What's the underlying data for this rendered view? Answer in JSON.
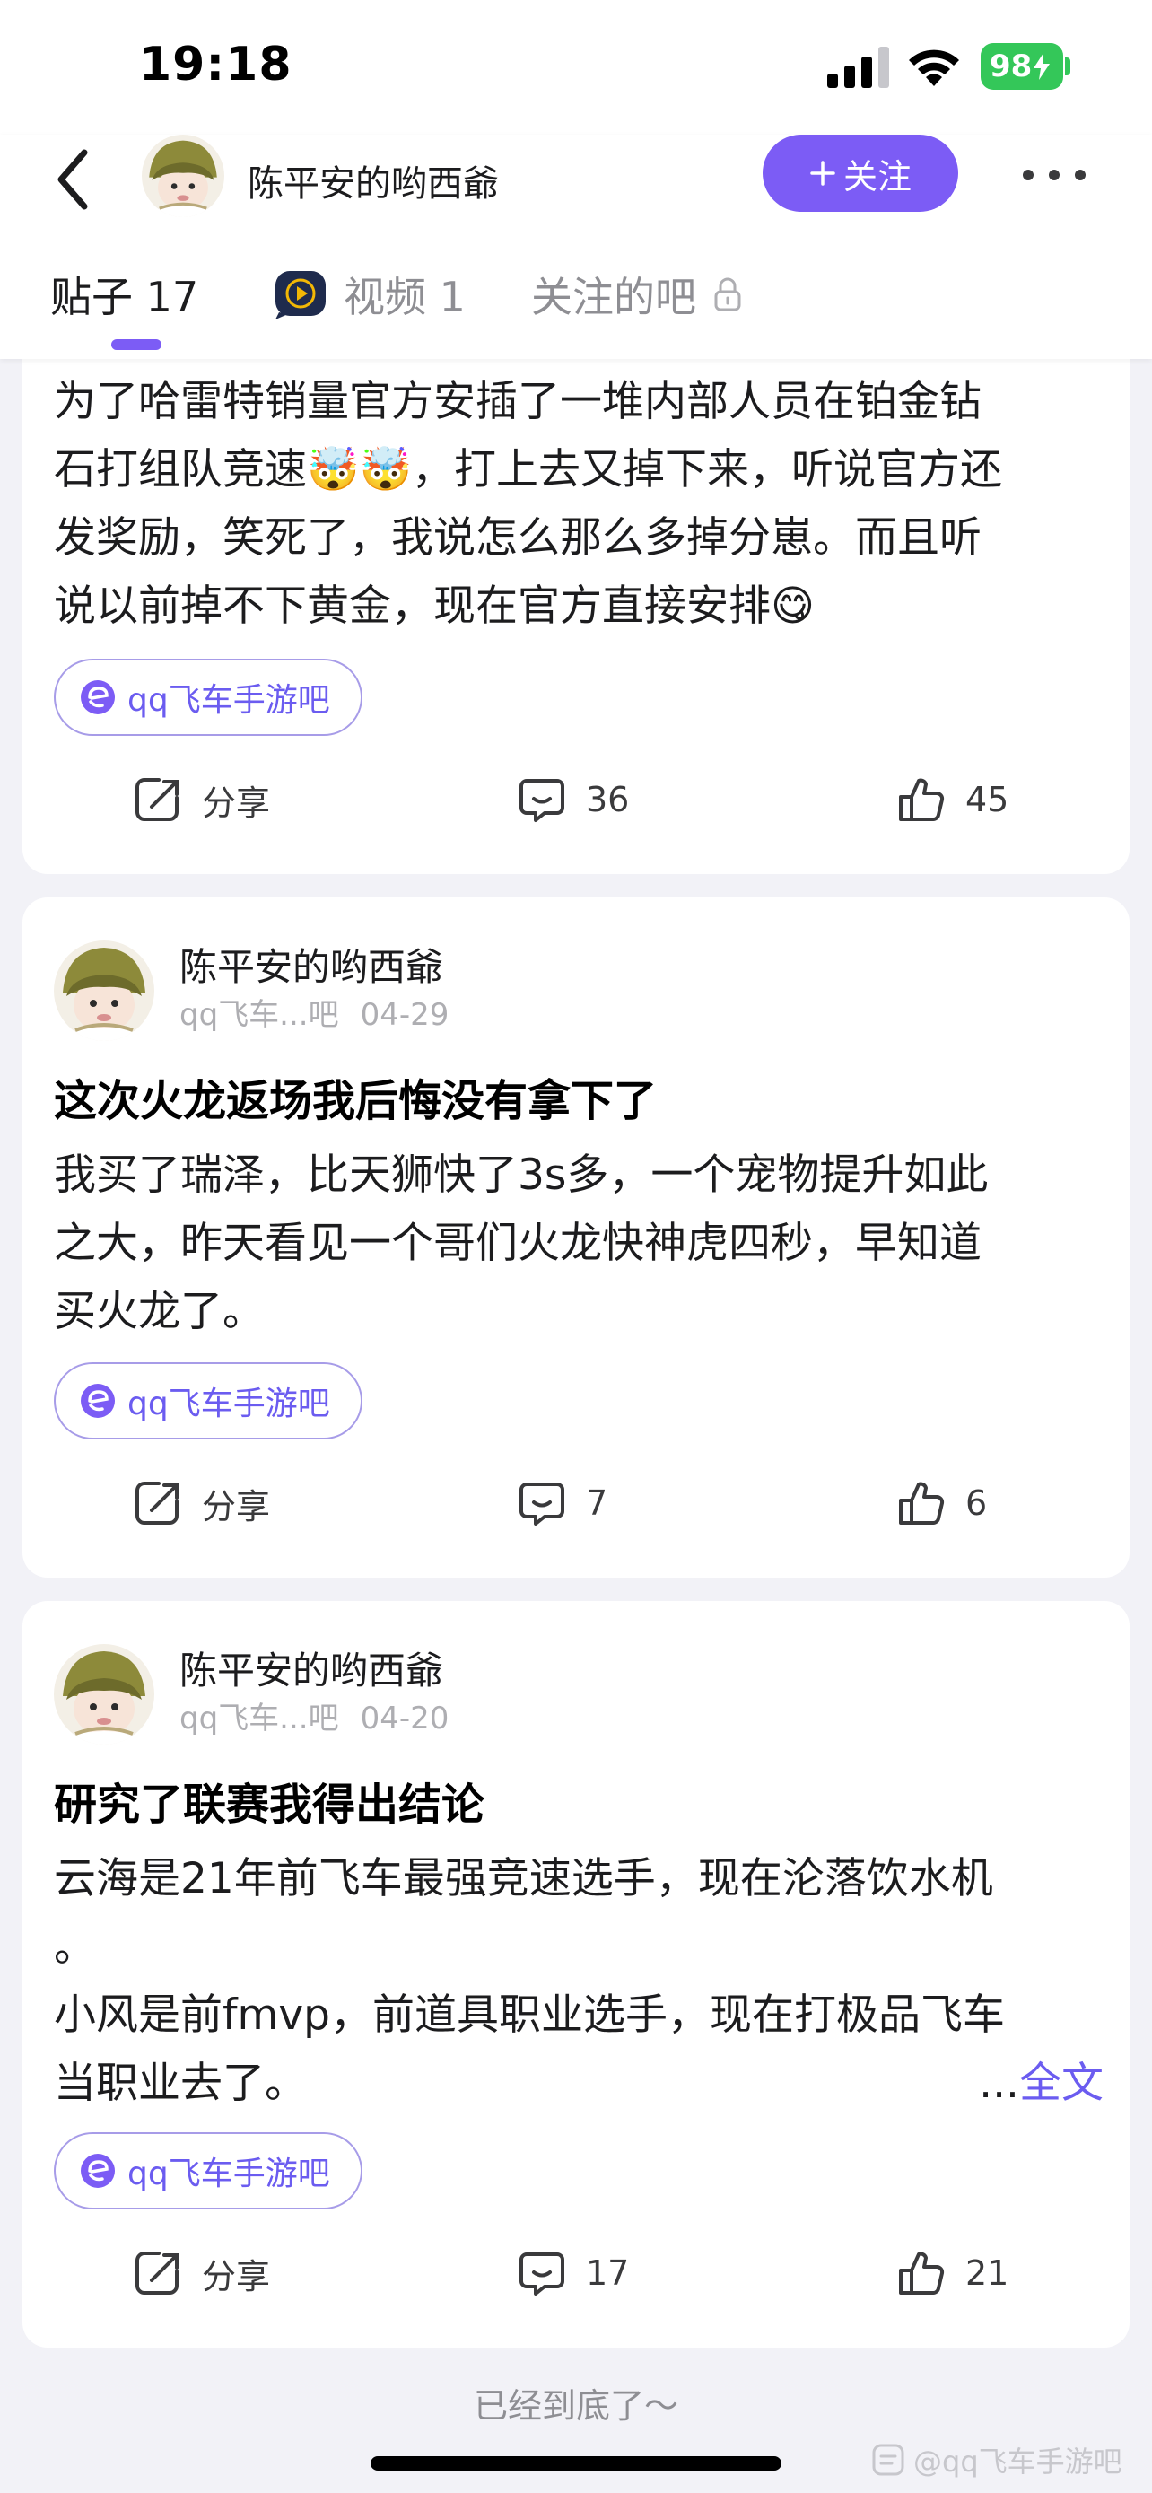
{
  "status_bar": {
    "time": "19:18",
    "battery": "98"
  },
  "nav": {
    "user_name": "陈平安的哟西爺",
    "follow_label": "关注",
    "tabs": {
      "posts": "贴子 17",
      "videos": "视频 1",
      "followed_bars": "关注的吧"
    }
  },
  "posts": [
    {
      "body_lines": [
        "为了哈雷特销量官方安插了一堆内部人员在铂金钻",
        "石打组队竞速🤯🤯，打上去又掉下来，听说官方还",
        "发奖励，笑死了，我说怎么那么多掉分崽。而且听",
        "说以前掉不下黄金，现在官方直接安排😋"
      ],
      "tag": "qq飞车手游吧",
      "share_label": "分享",
      "comments": "36",
      "likes": "45"
    },
    {
      "author": "陈平安的哟西爺",
      "forum": "qq飞车...吧",
      "date": "04-29",
      "title": "这次火龙返场我后悔没有拿下了",
      "body_lines": [
        "我买了瑞泽，比天狮快了3s多，一个宠物提升如此",
        "之大，昨天看见一个哥们火龙快神虎四秒，早知道",
        "买火龙了。"
      ],
      "tag": "qq飞车手游吧",
      "share_label": "分享",
      "comments": "7",
      "likes": "6"
    },
    {
      "author": "陈平安的哟西爺",
      "forum": "qq飞车...吧",
      "date": "04-20",
      "title": "研究了联赛我得出结论",
      "body_lines": [
        "云海是21年前飞车最强竞速选手，现在沦落饮水机",
        "。",
        "小风是前fmvp，前道具职业选手，现在打极品飞车",
        "当职业去了。"
      ],
      "ellipsis": "...",
      "full_text_label": "全文",
      "tag": "qq飞车手游吧",
      "share_label": "分享",
      "comments": "17",
      "likes": "21"
    }
  ],
  "footer": "已经到底了～",
  "watermark": "@qq飞车手游吧",
  "colors": {
    "accent": "#7c5cf5",
    "tag_text": "#6b5cf0",
    "battery": "#34c759"
  }
}
